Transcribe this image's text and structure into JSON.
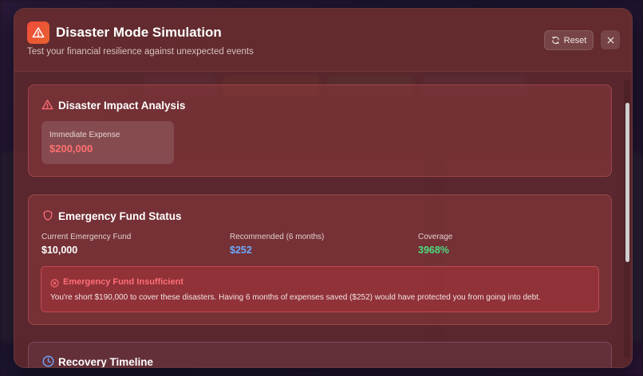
{
  "modal": {
    "title": "Disaster Mode Simulation",
    "subtitle": "Test your financial resilience against unexpected events",
    "reset_label": "Reset"
  },
  "impact": {
    "title": "Disaster Impact Analysis",
    "expense_label": "Immediate Expense",
    "expense_value": "$200,000"
  },
  "fund": {
    "title": "Emergency Fund Status",
    "stats": [
      {
        "label": "Current Emergency Fund",
        "value": "$10,000",
        "color": "#ffffff"
      },
      {
        "label": "Recommended (6 months)",
        "value": "$252",
        "color": "#6fa8ff"
      },
      {
        "label": "Coverage",
        "value": "3968%",
        "color": "#4ade80"
      }
    ],
    "alert": {
      "title": "Emergency Fund Insufficient",
      "message": "You're short $190,000 to cover these disasters. Having 6 months of expenses saved ($252) would have protected you from going into debt."
    }
  },
  "timeline": {
    "title": "Recovery Timeline"
  },
  "colors": {
    "accent": "#ef4b3a",
    "danger": "#ff6e78",
    "info": "#6fa8ff",
    "success": "#4ade80"
  },
  "icons": {
    "header": "warning-triangle-icon",
    "reset": "refresh-icon",
    "close": "close-icon",
    "impact": "warning-triangle-icon",
    "fund": "shield-icon",
    "alert": "x-circle-icon",
    "timeline": "clock-icon"
  }
}
